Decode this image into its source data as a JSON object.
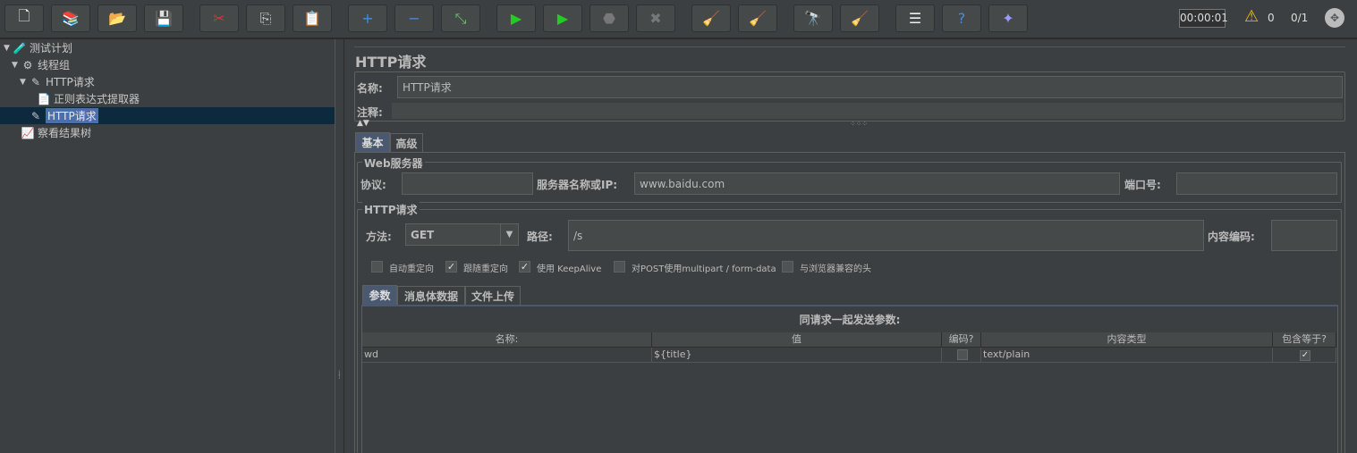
{
  "toolbar": {
    "buttons": [
      {
        "name": "new-icon",
        "glyph": "🗋"
      },
      {
        "name": "templates-icon",
        "glyph": "📚"
      },
      {
        "name": "open-icon",
        "glyph": "📂"
      },
      {
        "name": "save-icon",
        "glyph": "💾"
      },
      {
        "name": "cut-icon",
        "glyph": "✂"
      },
      {
        "name": "copy-icon",
        "glyph": "⎘"
      },
      {
        "name": "paste-icon",
        "glyph": "📋"
      },
      {
        "name": "expand-icon",
        "glyph": "+"
      },
      {
        "name": "collapse-icon",
        "glyph": "−"
      },
      {
        "name": "toggle-icon",
        "glyph": "⤡"
      },
      {
        "name": "start-icon",
        "glyph": "▶"
      },
      {
        "name": "start-no-pause-icon",
        "glyph": "▶"
      },
      {
        "name": "stop-icon",
        "glyph": "⬣"
      },
      {
        "name": "shutdown-icon",
        "glyph": "✖"
      },
      {
        "name": "clear-icon",
        "glyph": "🧹"
      },
      {
        "name": "clear-all-icon",
        "glyph": "🧹"
      },
      {
        "name": "search-icon",
        "glyph": "🔭"
      },
      {
        "name": "reset-search-icon",
        "glyph": "🧹"
      },
      {
        "name": "function-helper-icon",
        "glyph": "☰"
      },
      {
        "name": "help-icon",
        "glyph": "?"
      },
      {
        "name": "remote-icon",
        "glyph": "✦"
      }
    ],
    "timer": "00:00:01",
    "warning_count": "0",
    "threads": "0/1"
  },
  "tree": [
    {
      "label": "测试计划",
      "icon": "🧪",
      "expanded": true,
      "level": 0
    },
    {
      "label": "线程组",
      "icon": "⚙",
      "expanded": true,
      "level": 1
    },
    {
      "label": "HTTP请求",
      "icon": "✎",
      "expanded": true,
      "level": 2
    },
    {
      "label": "正则表达式提取器",
      "icon": "📄",
      "level": 3
    },
    {
      "label": "HTTP请求",
      "icon": "✎",
      "level": 2,
      "selected": true
    },
    {
      "label": "察看结果树",
      "icon": "📈",
      "level": 1
    }
  ],
  "panel": {
    "title": "HTTP请求",
    "name_label": "名称:",
    "name_value": "HTTP请求",
    "comment_label": "注释:",
    "comment_value": "",
    "tabs": [
      "基本",
      "高级"
    ],
    "web_server": {
      "legend": "Web服务器",
      "protocol_label": "协议:",
      "protocol_value": "",
      "server_label": "服务器名称或IP:",
      "server_value": "www.baidu.com",
      "port_label": "端口号:",
      "port_value": ""
    },
    "http_request": {
      "legend": "HTTP请求",
      "method_label": "方法:",
      "method_value": "GET",
      "path_label": "路径:",
      "path_value": "/s",
      "encoding_label": "内容编码:",
      "encoding_value": ""
    },
    "options": [
      {
        "label": "自动重定向",
        "checked": false
      },
      {
        "label": "跟随重定向",
        "checked": true
      },
      {
        "label": "使用 KeepAlive",
        "checked": true
      },
      {
        "label": "对POST使用multipart / form-data",
        "checked": false
      },
      {
        "label": "与浏览器兼容的头",
        "checked": false
      }
    ],
    "sub_tabs": [
      "参数",
      "消息体数据",
      "文件上传"
    ],
    "params_title": "同请求一起发送参数:",
    "columns": [
      "名称:",
      "值",
      "编码?",
      "内容类型",
      "包含等于?"
    ],
    "rows": [
      {
        "name": "wd",
        "value": "${title}",
        "encode": false,
        "content_type": "text/plain",
        "include_equals": true
      }
    ]
  }
}
